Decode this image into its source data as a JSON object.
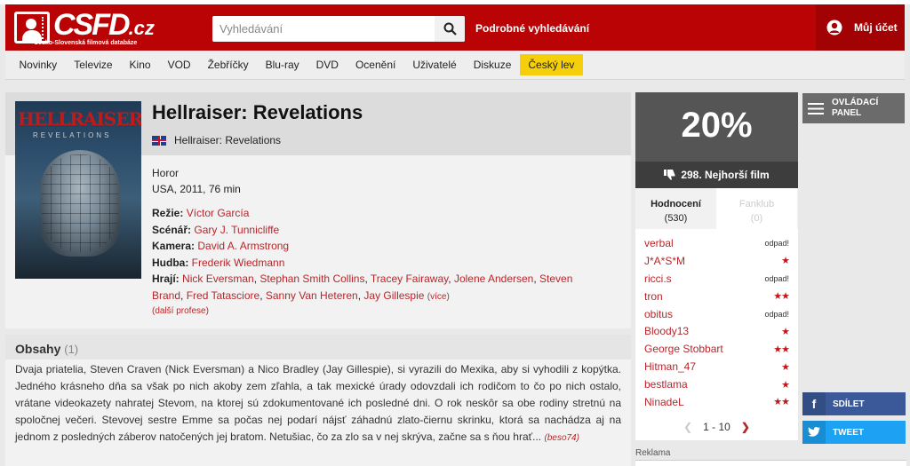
{
  "header": {
    "logo_text": "CSFD",
    "logo_tld": ".cz",
    "logo_subtitle": "Česko-Slovenská filmová databáze",
    "search_placeholder": "Vyhledávání",
    "advanced_search": "Podrobné vyhledávání",
    "account_label": "Můj účet"
  },
  "nav": {
    "items": [
      "Novinky",
      "Televize",
      "Kino",
      "VOD",
      "Žebříčky",
      "Blu-ray",
      "DVD",
      "Ocenění",
      "Uživatelé",
      "Diskuze",
      "Český lev"
    ]
  },
  "film": {
    "poster_title": "HELLRAISER",
    "poster_subtitle": "REVELATIONS",
    "title": "Hellraiser: Revelations",
    "original_title": "Hellraiser: Revelations",
    "genre": "Horor",
    "origin": "USA, 2011, 76 min",
    "directing_label": "Režie:",
    "directing": "Víctor García",
    "screenplay_label": "Scénář:",
    "screenplay": "Gary J. Tunnicliffe",
    "camera_label": "Kamera:",
    "camera": "David A. Armstrong",
    "music_label": "Hudba:",
    "music": "Frederik Wiedmann",
    "cast_label": "Hrají:",
    "cast": [
      "Nick Eversman",
      "Stephan Smith Collins",
      "Tracey Fairaway",
      "Jolene Andersen",
      "Steven Brand",
      "Fred Tatasciore",
      "Sanny Van Heteren",
      "Jay Gillespie"
    ],
    "more": "více",
    "more_professions": "(další profese)"
  },
  "plot": {
    "heading": "Obsahy",
    "count": "(1)",
    "text": "Dvaja priatelia, Steven Craven (Nick Eversman) a Nico Bradley (Jay Gillespie), si vyrazili do Mexika, aby si vyhodili z kopýtka. Jedného krásneho dňa sa však po nich akoby zem zľahla, a tak mexické úrady odovzdali ich rodičom to čo po nich ostalo, vrátane videokazety nahratej Stevom, na ktorej sú zdokumentované ich posledné dni. O rok neskôr sa obe rodiny stretnú na spoločnej večeri. Stevovej sestre Emme sa počas nej podarí nájsť záhadnú zlato-čiernu skrinku, ktorá sa nachádza aj na jednom z posledných záberov natočených jej bratom. Netušiac, čo za zlo sa v nej skrýva, začne sa s ňou hrať...",
    "author": "(beso74)"
  },
  "rating": {
    "percent": "20%",
    "worst_rank": "298. Nejhorší film",
    "tab_ratings": "Hodnocení",
    "tab_ratings_count": "(530)",
    "tab_fanclub": "Fanklub",
    "tab_fanclub_count": "(0)",
    "list": [
      {
        "user": "verbal",
        "value": "odpad!",
        "stars": 0
      },
      {
        "user": "J*A*S*M",
        "value": "",
        "stars": 1
      },
      {
        "user": "ricci.s",
        "value": "odpad!",
        "stars": 0
      },
      {
        "user": "tron",
        "value": "",
        "stars": 2
      },
      {
        "user": "obitus",
        "value": "odpad!",
        "stars": 0
      },
      {
        "user": "Bloody13",
        "value": "",
        "stars": 1
      },
      {
        "user": "George Stobbart",
        "value": "",
        "stars": 2
      },
      {
        "user": "Hitman_47",
        "value": "",
        "stars": 1
      },
      {
        "user": "bestlama",
        "value": "",
        "stars": 1
      },
      {
        "user": "NinadeL",
        "value": "",
        "stars": 2
      }
    ],
    "pager": "1 - 10"
  },
  "sidebar": {
    "panel_label_1": "OVLÁDACÍ",
    "panel_label_2": "PANEL",
    "share_fb": "SDÍLET",
    "share_tw": "TWEET",
    "ad_label": "Reklama"
  },
  "colors": {
    "brand_red": "#ba0305",
    "link_red": "#b8262a",
    "highlight_yellow": "#f5d00a"
  }
}
